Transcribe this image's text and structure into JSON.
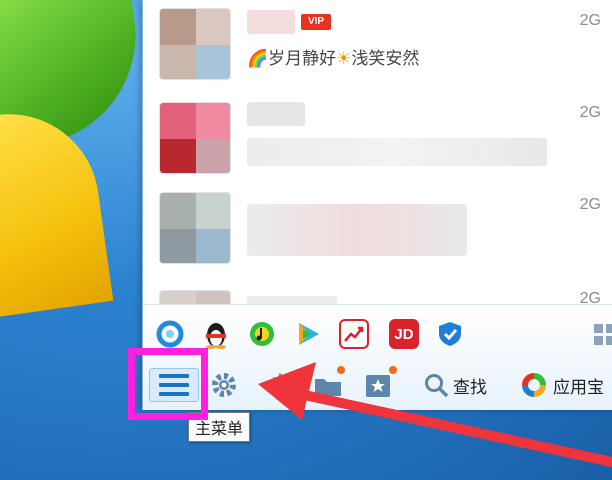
{
  "contacts": [
    {
      "network": "2G",
      "badge": "VIP",
      "signature": "岁月静好",
      "signature_2": "浅笑安然",
      "rainbow_glyph": "🌈",
      "sun_glyph": "☀"
    },
    {
      "network": "2G"
    },
    {
      "network": "2G"
    },
    {
      "network": "2G"
    }
  ],
  "apps": [
    {
      "icon": "qq-browser-icon",
      "color": "#1f8be0"
    },
    {
      "icon": "qq-penguin-icon",
      "color": "#f5a623"
    },
    {
      "icon": "music-icon",
      "color": "#2fbf3a"
    },
    {
      "icon": "video-play-icon",
      "color": "#27b5e8"
    },
    {
      "icon": "stock-chart-icon",
      "color": "#d8232a"
    },
    {
      "icon": "jd-icon",
      "label": "JD",
      "color": "#d8232a"
    },
    {
      "icon": "shield-icon",
      "color": "#1e7ed8"
    }
  ],
  "toolbar": {
    "main_menu_icon": "hamburger-menu-icon",
    "search_label": "查找",
    "app_center_label": "应用宝"
  },
  "tooltip": {
    "text": "主菜单"
  },
  "annotation": {
    "highlight_color": "#ff1fe0",
    "arrow_color": "#f0343c"
  }
}
